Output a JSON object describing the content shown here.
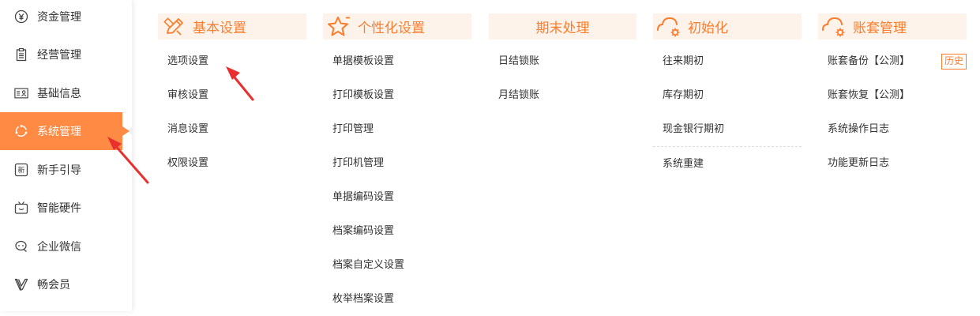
{
  "sidebar": {
    "items": [
      {
        "label": "资金管理",
        "icon": "yen-icon"
      },
      {
        "label": "经营管理",
        "icon": "clipboard-icon"
      },
      {
        "label": "基础信息",
        "icon": "id-card-icon"
      },
      {
        "label": "系统管理",
        "icon": "cycle-icon",
        "active": true
      },
      {
        "label": "新手引导",
        "icon": "new-badge-icon"
      },
      {
        "label": "智能硬件",
        "icon": "tv-icon"
      },
      {
        "label": "企业微信",
        "icon": "chat-bubble-icon"
      },
      {
        "label": "畅会员",
        "icon": "v-logo-icon"
      }
    ]
  },
  "columns": {
    "basic": {
      "title": "基本设置",
      "items": [
        "选项设置",
        "审核设置",
        "消息设置",
        "权限设置"
      ]
    },
    "personal": {
      "title": "个性化设置",
      "items": [
        "单据模板设置",
        "打印模板设置",
        "打印管理",
        "打印机管理",
        "单据编码设置",
        "档案编码设置",
        "档案自定义设置",
        "枚举档案设置"
      ]
    },
    "period_end": {
      "title": "期末处理",
      "items": [
        "日结锁账",
        "月结锁账"
      ]
    },
    "init": {
      "title": "初始化",
      "items": [
        "往来期初",
        "库存期初",
        "现金银行期初",
        "系统重建"
      ]
    },
    "accounts": {
      "title": "账套管理",
      "items": [
        "账套备份【公测】",
        "账套恢复【公测】",
        "系统操作日志",
        "功能更新日志"
      ],
      "history_badge": "历史"
    }
  },
  "colors": {
    "accent": "#fe8a43",
    "header_bg": "#fef3ea",
    "header_text": "#fa7d2d",
    "arrow": "#e8312f"
  }
}
